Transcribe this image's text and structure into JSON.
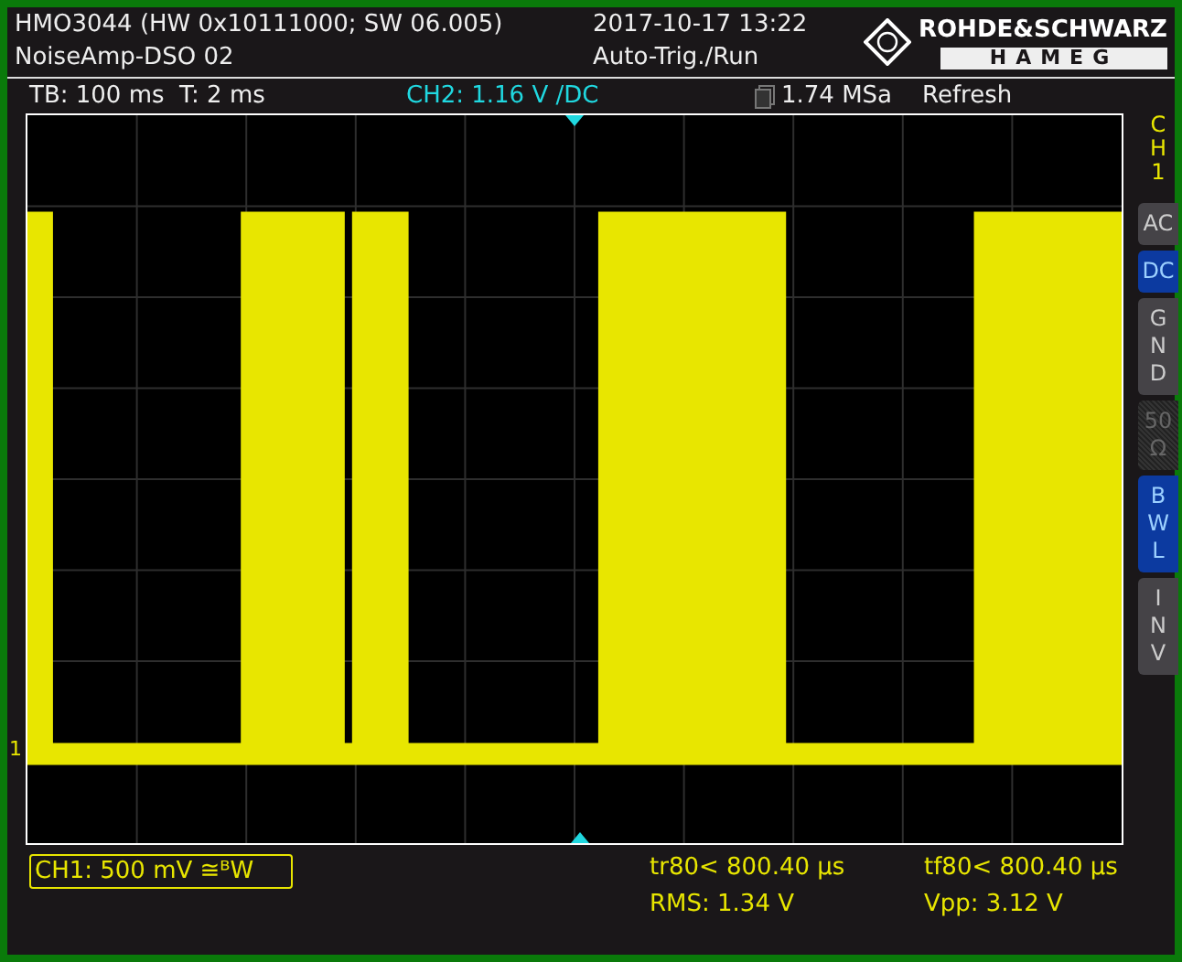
{
  "header": {
    "model": "HMO3044 (HW 0x10111000; SW 06.005)",
    "setup": "NoiseAmp-DSO 02",
    "datetime": "2017-10-17 13:22",
    "trigger_mode": "Auto-Trig./Run"
  },
  "logo": {
    "line1": "ROHDE&SCHWARZ",
    "line2": "HAMEG"
  },
  "status": {
    "timebase": "TB: 100 ms  T: 2 ms",
    "trigger_channel": "CH2: 1.16 V ∕DC",
    "sample_rate": "1.74 MSa",
    "acquire_mode": "Refresh"
  },
  "channel_marker": "1",
  "side_panel": {
    "channel_label": "CH1",
    "buttons": [
      {
        "lines": [
          "AC"
        ],
        "on": false,
        "disabled": false
      },
      {
        "lines": [
          "DC"
        ],
        "on": true,
        "disabled": false
      },
      {
        "lines": [
          "G",
          "N",
          "D"
        ],
        "on": false,
        "disabled": false
      },
      {
        "lines": [
          "50",
          "Ω"
        ],
        "on": false,
        "disabled": true
      },
      {
        "lines": [
          "B",
          "W",
          "L"
        ],
        "on": true,
        "disabled": false
      },
      {
        "lines": [
          "I",
          "N",
          "V"
        ],
        "on": false,
        "disabled": false
      }
    ]
  },
  "channel_info": "CH1: 500 mV ≅ᴮW",
  "measurements": [
    {
      "text": "tr80< 800.40 µs"
    },
    {
      "text": "tf80< 800.40 µs"
    },
    {
      "text": "RMS: 1.34 V"
    },
    {
      "text": "Vpp: 3.12 V"
    }
  ]
}
